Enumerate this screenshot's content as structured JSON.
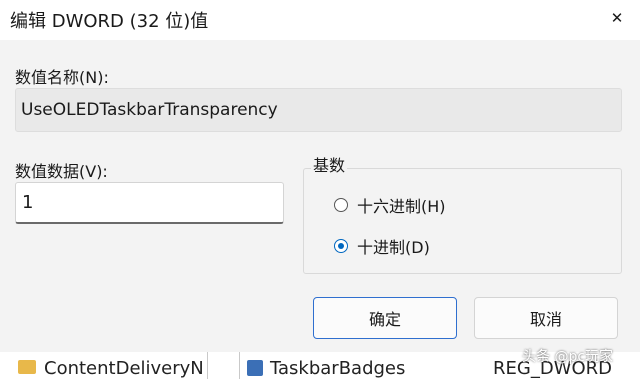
{
  "window": {
    "title": "编辑 DWORD (32 位)值",
    "close_glyph": "✕"
  },
  "value_name": {
    "label": "数值名称(N):",
    "value": "UseOLEDTaskbarTransparency"
  },
  "value_data": {
    "label": "数值数据(V):",
    "value": "1"
  },
  "base": {
    "label": "基数",
    "options": [
      {
        "label": "十六进制(H)",
        "checked": false
      },
      {
        "label": "十进制(D)",
        "checked": true
      }
    ]
  },
  "buttons": {
    "ok": "确定",
    "cancel": "取消"
  },
  "background_row": {
    "folder_name": "ContentDeliveryN",
    "entry_name": "TaskbarBadges",
    "entry_type": "REG_DWORD"
  },
  "watermark": "头条 @pc玩家",
  "colors": {
    "accent": "#0067c0",
    "ok_border": "#2f6fcf",
    "dialog_bg": "#f3f3f3"
  }
}
